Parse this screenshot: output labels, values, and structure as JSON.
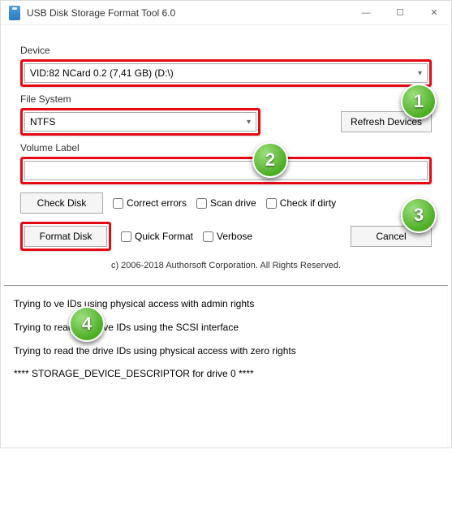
{
  "window": {
    "title": "USB Disk Storage Format Tool 6.0"
  },
  "labels": {
    "device": "Device",
    "filesystem": "File System",
    "volume": "Volume Label"
  },
  "fields": {
    "device_value": "VID:82  NCard  0.2 (7,41 GB) (D:\\)",
    "filesystem_value": "NTFS",
    "volume_value": ""
  },
  "buttons": {
    "refresh": "Refresh Devices",
    "check_disk": "Check Disk",
    "format_disk": "Format Disk",
    "cancel": "Cancel"
  },
  "checkboxes": {
    "correct_errors": "Correct errors",
    "scan_drive": "Scan drive",
    "check_dirty": "Check if dirty",
    "quick_format": "Quick Format",
    "verbose": "Verbose"
  },
  "copyright": "c) 2006-2018 Authorsoft Corporation. All Rights Reserved.",
  "log": {
    "l1": "Trying to                 ve IDs using physical access with admin rights",
    "l2": "Trying to read the drive IDs using the SCSI interface",
    "l3": "Trying to read the drive IDs using physical access with zero rights",
    "l4": "**** STORAGE_DEVICE_DESCRIPTOR for drive 0 ****"
  },
  "callouts": {
    "c1": "1",
    "c2": "2",
    "c3": "3",
    "c4": "4"
  }
}
